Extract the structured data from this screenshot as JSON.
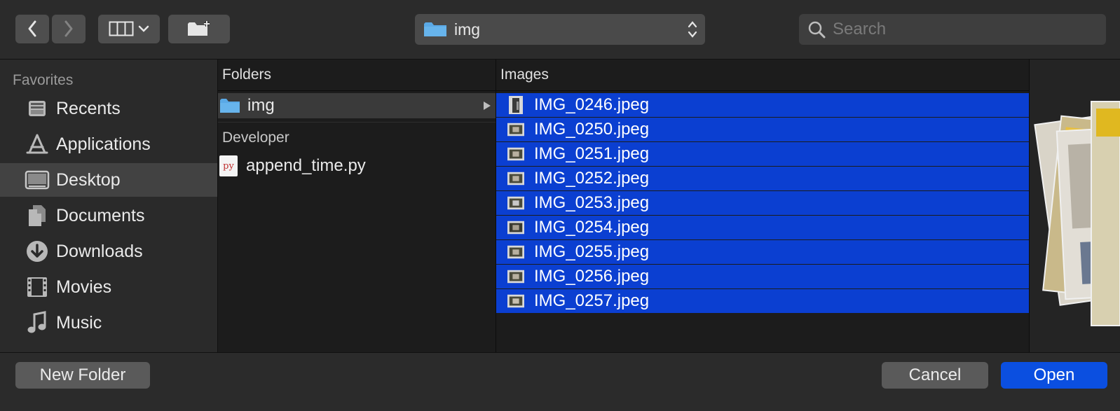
{
  "toolbar": {
    "path": "img",
    "search_placeholder": "Search"
  },
  "sidebar": {
    "section": "Favorites",
    "items": [
      {
        "label": "Recents"
      },
      {
        "label": "Applications"
      },
      {
        "label": "Desktop"
      },
      {
        "label": "Documents"
      },
      {
        "label": "Downloads"
      },
      {
        "label": "Movies"
      },
      {
        "label": "Music"
      }
    ]
  },
  "folders_column": {
    "header": "Folders",
    "folder": "img",
    "group": "Developer",
    "file": "append_time.py",
    "file_badge": "py"
  },
  "images_column": {
    "header": "Images",
    "files": [
      "IMG_0246.jpeg",
      "IMG_0250.jpeg",
      "IMG_0251.jpeg",
      "IMG_0252.jpeg",
      "IMG_0253.jpeg",
      "IMG_0254.jpeg",
      "IMG_0255.jpeg",
      "IMG_0256.jpeg",
      "IMG_0257.jpeg"
    ]
  },
  "footer": {
    "new_folder": "New Folder",
    "cancel": "Cancel",
    "open": "Open"
  },
  "colors": {
    "selection": "#0b3fd1",
    "primary_button": "#0b4fe0",
    "folder": "#5aa9e6"
  }
}
